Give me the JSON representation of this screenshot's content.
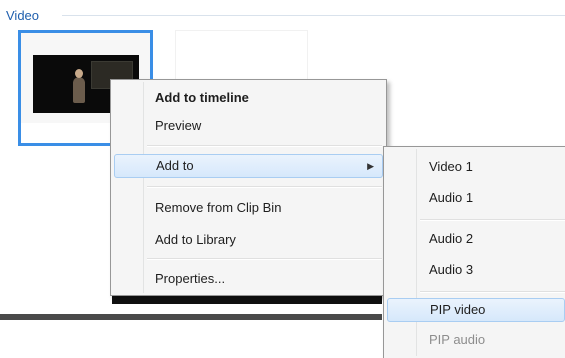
{
  "section": {
    "label": "Video"
  },
  "context_menu": {
    "items": [
      {
        "label": "Add to timeline"
      },
      {
        "label": "Preview"
      },
      {
        "label": "Add to"
      },
      {
        "label": "Remove from Clip Bin"
      },
      {
        "label": "Add to Library"
      },
      {
        "label": "Properties..."
      }
    ]
  },
  "submenu": {
    "items": [
      {
        "label": "Video 1"
      },
      {
        "label": "Audio 1"
      },
      {
        "label": "Audio 2"
      },
      {
        "label": "Audio 3"
      },
      {
        "label": "PIP video"
      },
      {
        "label": "PIP audio"
      }
    ]
  },
  "icons": {
    "submenu_arrow": "chevron-right-icon"
  },
  "colors": {
    "accent": "#3a8ee6",
    "section_label": "#1f5fae",
    "highlight": "#d6e8fb"
  }
}
